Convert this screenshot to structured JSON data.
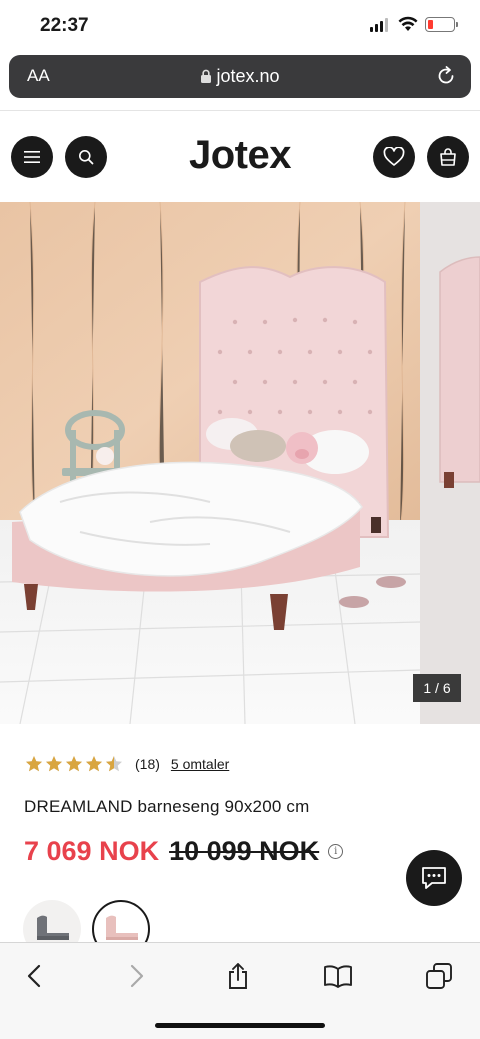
{
  "status_bar": {
    "time": "22:37"
  },
  "browser": {
    "text_size_label": "AA",
    "url": "jotex.no"
  },
  "site": {
    "logo": "Jotex"
  },
  "header_icons": [
    "menu-icon",
    "search-icon",
    "heart-icon",
    "shopping-bag-icon"
  ],
  "carousel": {
    "counter": "1 / 6"
  },
  "product": {
    "rating": 4.5,
    "rating_count": "(18)",
    "reviews_link": "5 omtaler",
    "title": "DREAMLAND barneseng 90x200 cm",
    "price": "7 069 NOK",
    "old_price": "10 099 NOK"
  },
  "colors": {
    "sale_red": "#e8424c",
    "star_gold": "#d9a53f",
    "dark": "#1a1a1a"
  },
  "toolbar_icons": [
    "back-icon",
    "forward-icon",
    "share-icon",
    "bookmarks-icon",
    "tabs-icon"
  ]
}
